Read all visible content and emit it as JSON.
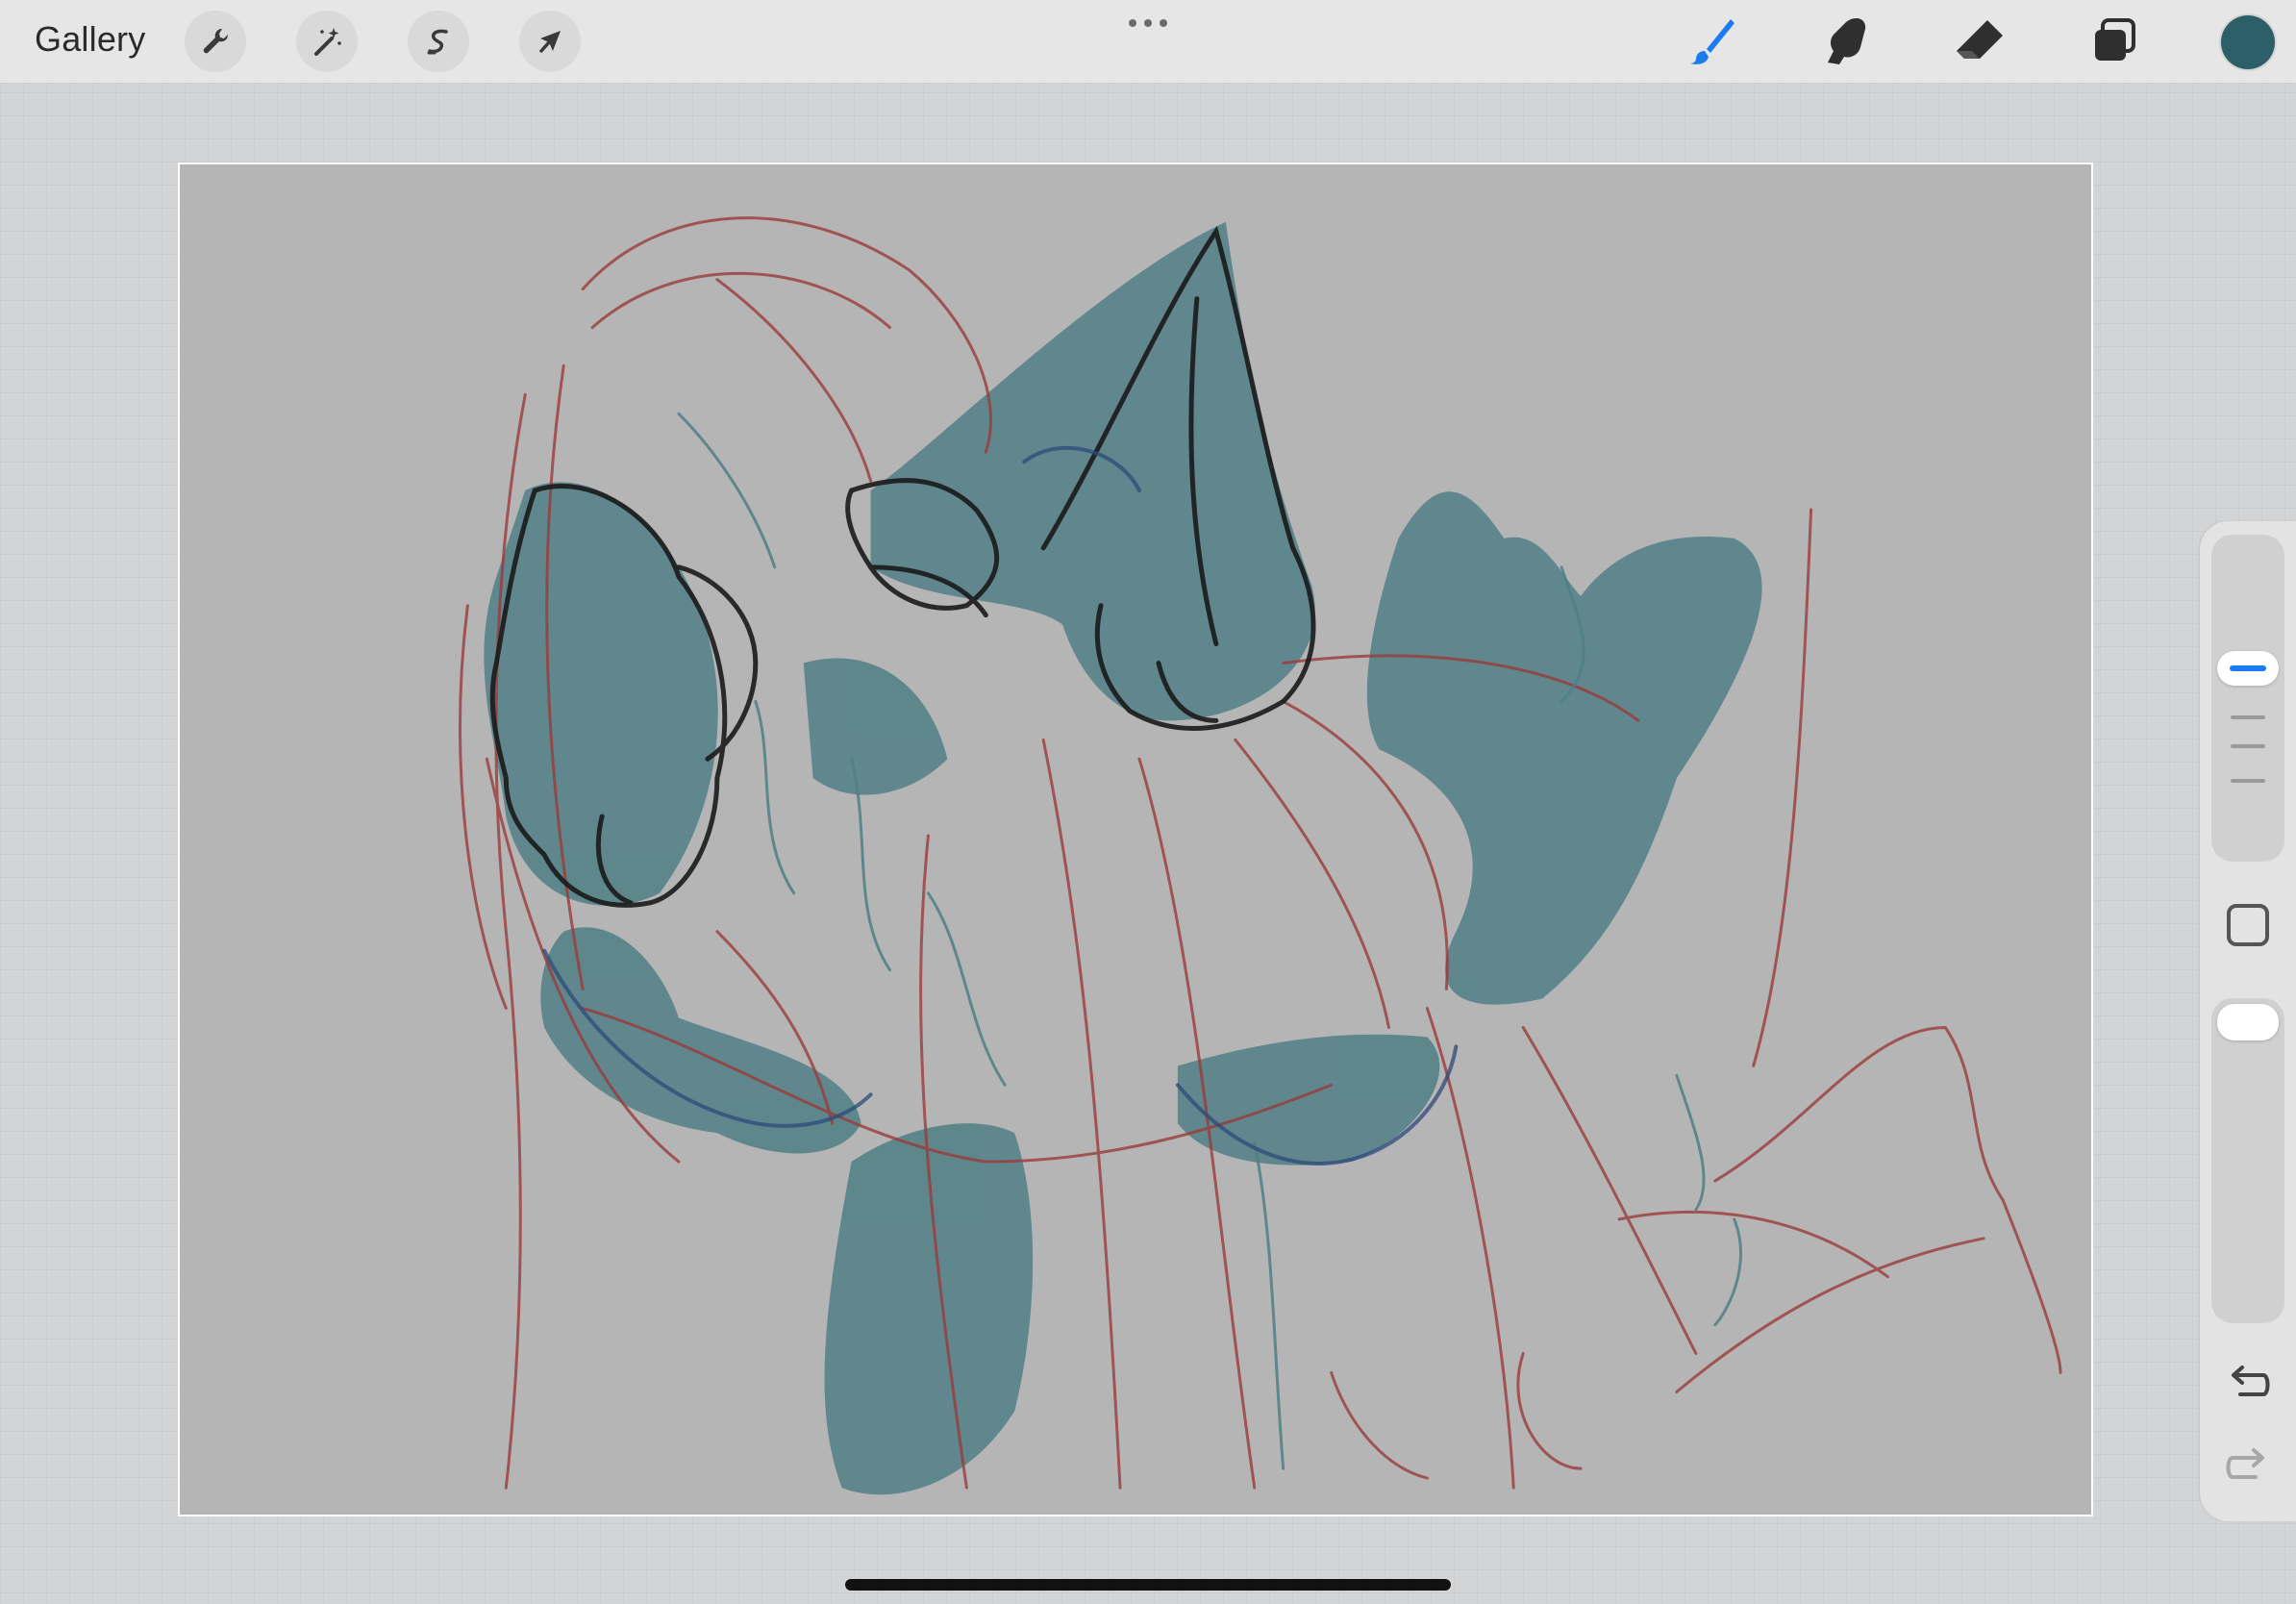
{
  "topbar": {
    "gallery_label": "Gallery",
    "left_tools": [
      {
        "name": "actions",
        "icon": "wrench-icon"
      },
      {
        "name": "adjustments",
        "icon": "magic-wand-icon"
      },
      {
        "name": "selection",
        "icon": "selection-s-icon"
      },
      {
        "name": "transform",
        "icon": "arrow-cursor-icon"
      }
    ],
    "more_icon": "more-dots-icon",
    "right_tools": [
      {
        "name": "brush",
        "icon": "brush-icon",
        "active": true
      },
      {
        "name": "smudge",
        "icon": "smudge-finger-icon",
        "active": false
      },
      {
        "name": "eraser",
        "icon": "eraser-icon",
        "active": false
      },
      {
        "name": "layers",
        "icon": "layers-icon",
        "active": false
      }
    ],
    "current_color": "#2c5f68"
  },
  "colors": {
    "active_tool": "#1a7cf0",
    "inactive_tool": "#2f2f2f",
    "canvas_bg": "#b5b5b5",
    "sketch_red": "#9a3b3b",
    "sketch_teal": "#4f7f86",
    "ink": "#1a1a1a"
  },
  "sidebar": {
    "brush_size": 0.34,
    "brush_opacity": 1.0,
    "undo_icon": "undo-icon",
    "redo_icon": "redo-icon",
    "redo_enabled": false
  }
}
